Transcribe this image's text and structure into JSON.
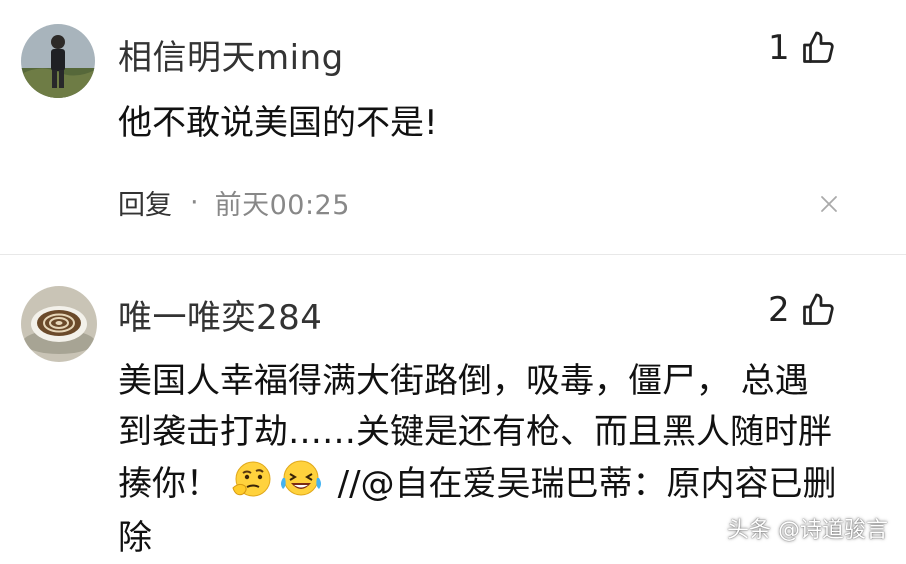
{
  "comments": [
    {
      "username": "相信明天ming",
      "like_count": "1",
      "text": "他不敢说美国的不是!",
      "reply_label": "回复",
      "separator": "·",
      "timestamp": "前天00:25"
    },
    {
      "username": "唯一唯奕284",
      "like_count": "2",
      "text_line1": "美国人幸福得满大街路倒，吸毒，僵尸， 总遇",
      "text_line2": "到袭击打劫……关键是还有枪、而且黑人随时胖",
      "text_line3_start": "揍你！",
      "text_line3_end": "//@自在爱吴瑞巴蒂：原内容已删",
      "text_line4": "除"
    }
  ],
  "watermark": "头条 @诗道骏言",
  "colors": {
    "text": "#111111",
    "meta": "#888888",
    "divider": "#e8e8e8"
  },
  "icons": [
    "thumbs-up-icon",
    "close-icon",
    "thinking-emoji-icon",
    "laughing-crying-emoji-icon"
  ]
}
